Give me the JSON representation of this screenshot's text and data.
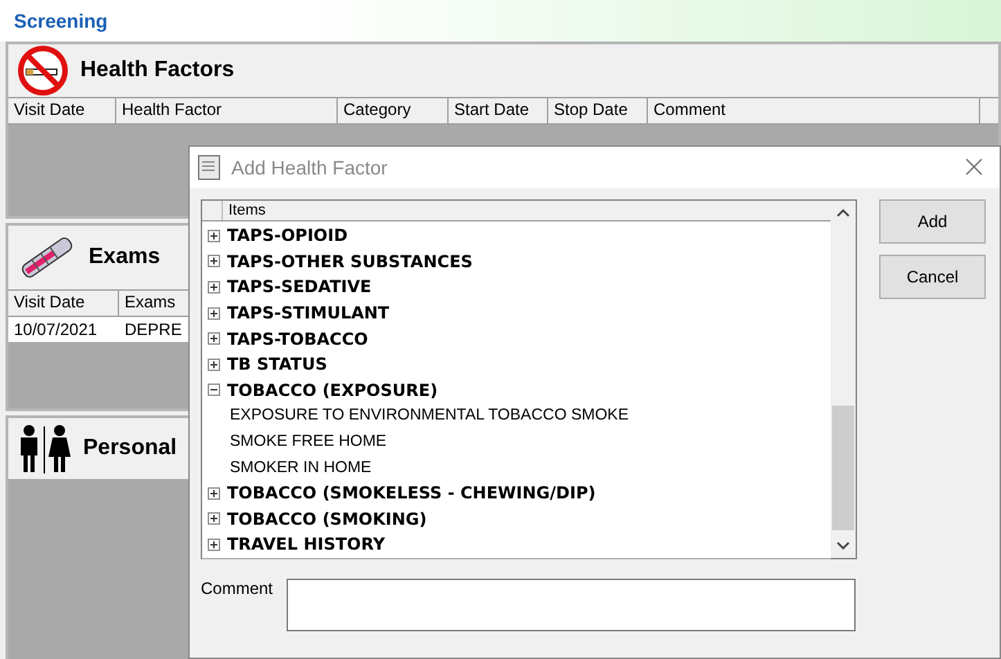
{
  "header": {
    "title": "Screening"
  },
  "health_factors": {
    "title": "Health Factors",
    "columns": [
      "Visit Date",
      "Health Factor",
      "Category",
      "Start Date",
      "Stop Date",
      "Comment"
    ]
  },
  "exams": {
    "title": "Exams",
    "columns": [
      "Visit Date",
      "Exams"
    ],
    "rows": [
      [
        "10/07/2021",
        "DEPRE"
      ]
    ]
  },
  "personal": {
    "title": "Personal"
  },
  "dialog": {
    "title": "Add Health Factor",
    "list": {
      "column": "Items",
      "items": [
        {
          "label": "TAPS-OPIOID",
          "expanded": false
        },
        {
          "label": "TAPS-OTHER SUBSTANCES",
          "expanded": false
        },
        {
          "label": "TAPS-SEDATIVE",
          "expanded": false
        },
        {
          "label": "TAPS-STIMULANT",
          "expanded": false
        },
        {
          "label": "TAPS-TOBACCO",
          "expanded": false
        },
        {
          "label": "TB STATUS",
          "expanded": false
        },
        {
          "label": "TOBACCO (EXPOSURE)",
          "expanded": true,
          "children": [
            {
              "label": "EXPOSURE TO ENVIRONMENTAL TOBACCO SMOKE"
            },
            {
              "label": "SMOKE FREE HOME"
            },
            {
              "label": "SMOKER IN HOME"
            }
          ]
        },
        {
          "label": "TOBACCO (SMOKELESS - CHEWING/DIP)",
          "expanded": false
        },
        {
          "label": "TOBACCO (SMOKING)",
          "expanded": false
        },
        {
          "label": "TRAVEL HISTORY",
          "expanded": false
        }
      ]
    },
    "comment_label": "Comment",
    "buttons": [
      "Add",
      "Cancel"
    ]
  }
}
